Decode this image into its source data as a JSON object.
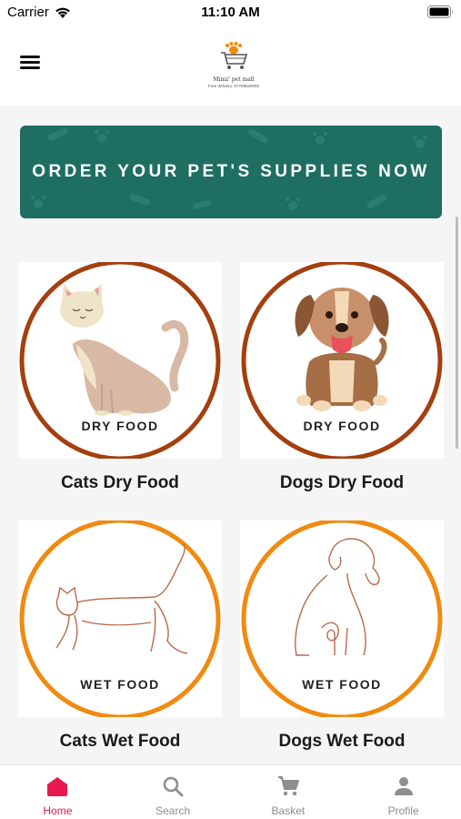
{
  "status_bar": {
    "carrier": "Carrier",
    "time": "11:10 AM"
  },
  "header": {
    "logo_name": "Mimz' pet mall",
    "logo_phone": "Free delivery: 07799626060"
  },
  "banner": {
    "text": "ORDER YOUR PET'S SUPPLIES NOW"
  },
  "categories": [
    {
      "badge": "DRY FOOD",
      "title": "Cats Dry Food",
      "ring_color": "#a43f0f",
      "image": "cat-sitting"
    },
    {
      "badge": "DRY FOOD",
      "title": "Dogs Dry Food",
      "ring_color": "#a43f0f",
      "image": "dog-sitting"
    },
    {
      "badge": "WET FOOD",
      "title": "Cats Wet Food",
      "ring_color": "#f08a10",
      "image": "cat-line-art"
    },
    {
      "badge": "WET FOOD",
      "title": "Dogs Wet Food",
      "ring_color": "#f08a10",
      "image": "dog-line-art"
    }
  ],
  "tabbar": {
    "active_color": "#e8194d",
    "items": [
      {
        "label": "Home",
        "icon": "home-icon",
        "active": true
      },
      {
        "label": "Search",
        "icon": "search-icon",
        "active": false
      },
      {
        "label": "Basket",
        "icon": "cart-icon",
        "active": false
      },
      {
        "label": "Profile",
        "icon": "person-icon",
        "active": false
      }
    ]
  },
  "colors": {
    "banner": "#1e6e62",
    "accent": "#e8194d"
  }
}
